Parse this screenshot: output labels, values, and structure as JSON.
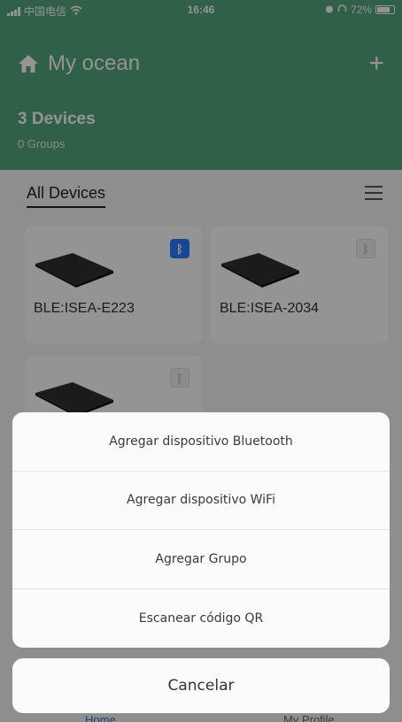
{
  "status_bar": {
    "carrier": "中国电信",
    "time": "16:46",
    "battery": "72%"
  },
  "header": {
    "title": "My ocean",
    "devices_count": "3 Devices",
    "groups_count": "0 Groups",
    "add_symbol": "+"
  },
  "tabs": {
    "all_devices": "All Devices"
  },
  "devices": [
    {
      "name": "BLE:ISEA-E223",
      "bluetooth_connected": true
    },
    {
      "name": "BLE:ISEA-2034",
      "bluetooth_connected": false
    },
    {
      "name": "",
      "bluetooth_connected": false
    }
  ],
  "bottom_nav": {
    "home": "Home",
    "me": "My Profile"
  },
  "action_sheet": {
    "items": [
      "Agregar dispositivo Bluetooth",
      "Agregar dispositivo WiFi",
      "Agregar Grupo",
      "Escanear código QR"
    ],
    "cancel": "Cancelar"
  },
  "colors": {
    "header_bg": "#53a67c",
    "bluetooth_active": "#2d7bff"
  }
}
